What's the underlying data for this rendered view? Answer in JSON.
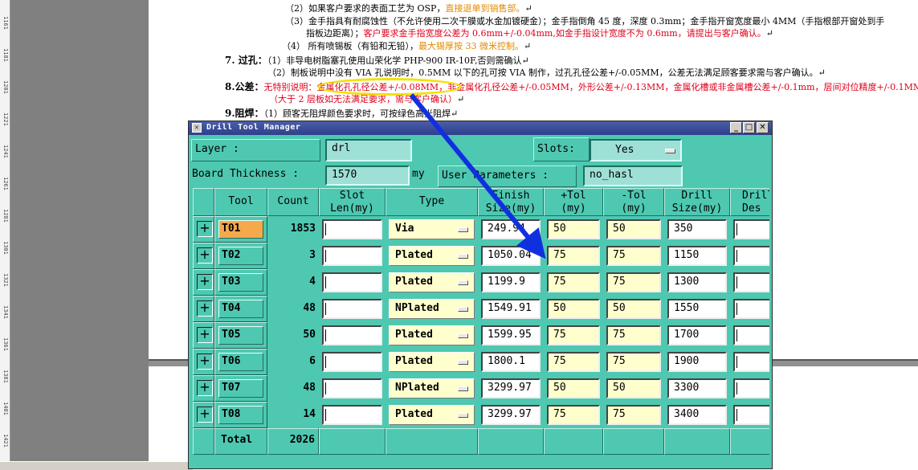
{
  "document": {
    "ruler_marks": [
      "1161",
      "1181",
      "1201",
      "1221",
      "1241",
      "1261",
      "1281",
      "1301",
      "1321",
      "1341",
      "1361",
      "1381",
      "1401",
      "1421"
    ],
    "lines": {
      "l1": [
        "（2）如果客户要求的表面工艺为 OSP，",
        "直接退单到销售部。",
        "↵"
      ],
      "l2": "（3）金手指具有耐腐蚀性（不允许使用二次干膜或水金加镀硬金）；金手指倒角 45 度，深度 0.3mm；金手指开窗宽度最小 4MM（手指根部开窗处到手",
      "l3": [
        "指板边距离）；",
        "客户要求金手指宽度公差为 0.6mm+/-0.04mm,如金手指设计宽度不为 0.6mm，请提出与客户确认。",
        "↵"
      ],
      "l4": [
        "（4）  所有喷锡板（有铅和无铅），",
        "最大锡厚按 33 微米控制。",
        "↵"
      ],
      "l5": [
        "7. 过孔：",
        "（1）非导电树脂塞孔使用山荣化学 PHP-900 IR-10F,否则需确认↵"
      ],
      "l6": "（2）制板说明中没有 VIA 孔说明时，0.5MM 以下的孔可按 VIA 制作，过孔孔径公差+/-0.05MM，公差无法满足顾客要求需与客户确认。↵",
      "l7": [
        "8.公差：",
        "无特别说明：金属化孔孔径公差+/-0.08MM，非金属化孔径公差+/-0.05MM，外形公差+/-0.13MM，金属化槽或非金属槽公差+/-0.1mm，层间对位精度+/-0.1MM"
      ],
      "l8": [
        "（大于 2 层板如无法满足要求，需与客户确认）",
        "↵"
      ],
      "l9": [
        "9.阻焊：",
        "（1）顾客无阻焊颜色要求时，可按绿色高光阻焊↵"
      ]
    }
  },
  "window": {
    "title": "Drill Tool Manager",
    "controls": {
      "minimize": "_",
      "maximize": "□",
      "close": "✕"
    },
    "layer_label": "Layer        :",
    "layer_value": "drl",
    "slots_label": "Slots:",
    "slots_value": "Yes",
    "board_thickness_label": "Board Thickness :",
    "board_thickness_value": "1570",
    "board_thickness_unit": "my",
    "user_params_label": "User Parameters :",
    "user_params_value": "no_hasl",
    "columns": {
      "tool": "Tool",
      "count": "Count",
      "slot_len_1": "Slot",
      "slot_len_2": "Len(my)",
      "type": "Type",
      "finish_1": "Finish",
      "finish_2": "Size(my)",
      "ptol_1": "+Tol",
      "ptol_2": "(my)",
      "mtol_1": "-Tol",
      "mtol_2": "(my)",
      "drill_1": "Drill",
      "drill_2": "Size(my)",
      "desc_1": "Drill",
      "desc_2": "Des"
    },
    "plus_glyph": "+",
    "rows": [
      {
        "tool": "T01",
        "count": "1853",
        "type": "Via",
        "finish": "249.94",
        "ptol": "50",
        "mtol": "50",
        "drill": "350"
      },
      {
        "tool": "T02",
        "count": "3",
        "type": "Plated",
        "finish": "1050.04",
        "ptol": "75",
        "mtol": "75",
        "drill": "1150"
      },
      {
        "tool": "T03",
        "count": "4",
        "type": "Plated",
        "finish": "1199.9",
        "ptol": "75",
        "mtol": "75",
        "drill": "1300"
      },
      {
        "tool": "T04",
        "count": "48",
        "type": "NPlated",
        "finish": "1549.91",
        "ptol": "50",
        "mtol": "50",
        "drill": "1550"
      },
      {
        "tool": "T05",
        "count": "50",
        "type": "Plated",
        "finish": "1599.95",
        "ptol": "75",
        "mtol": "75",
        "drill": "1700"
      },
      {
        "tool": "T06",
        "count": "6",
        "type": "Plated",
        "finish": "1800.1",
        "ptol": "75",
        "mtol": "75",
        "drill": "1900"
      },
      {
        "tool": "T07",
        "count": "48",
        "type": "NPlated",
        "finish": "3299.97",
        "ptol": "50",
        "mtol": "50",
        "drill": "3300"
      },
      {
        "tool": "T08",
        "count": "14",
        "type": "Plated",
        "finish": "3299.97",
        "ptol": "75",
        "mtol": "75",
        "drill": "3400"
      }
    ],
    "total_label": "Total",
    "total_count": "2026"
  },
  "colors": {
    "window_bg": "#4ec8b1",
    "selected_tool": "#f6a94a",
    "input_yellow": "#ffffce",
    "annotation_arrow": "#1030e0",
    "annotation_ellipse": "#f4e000"
  }
}
